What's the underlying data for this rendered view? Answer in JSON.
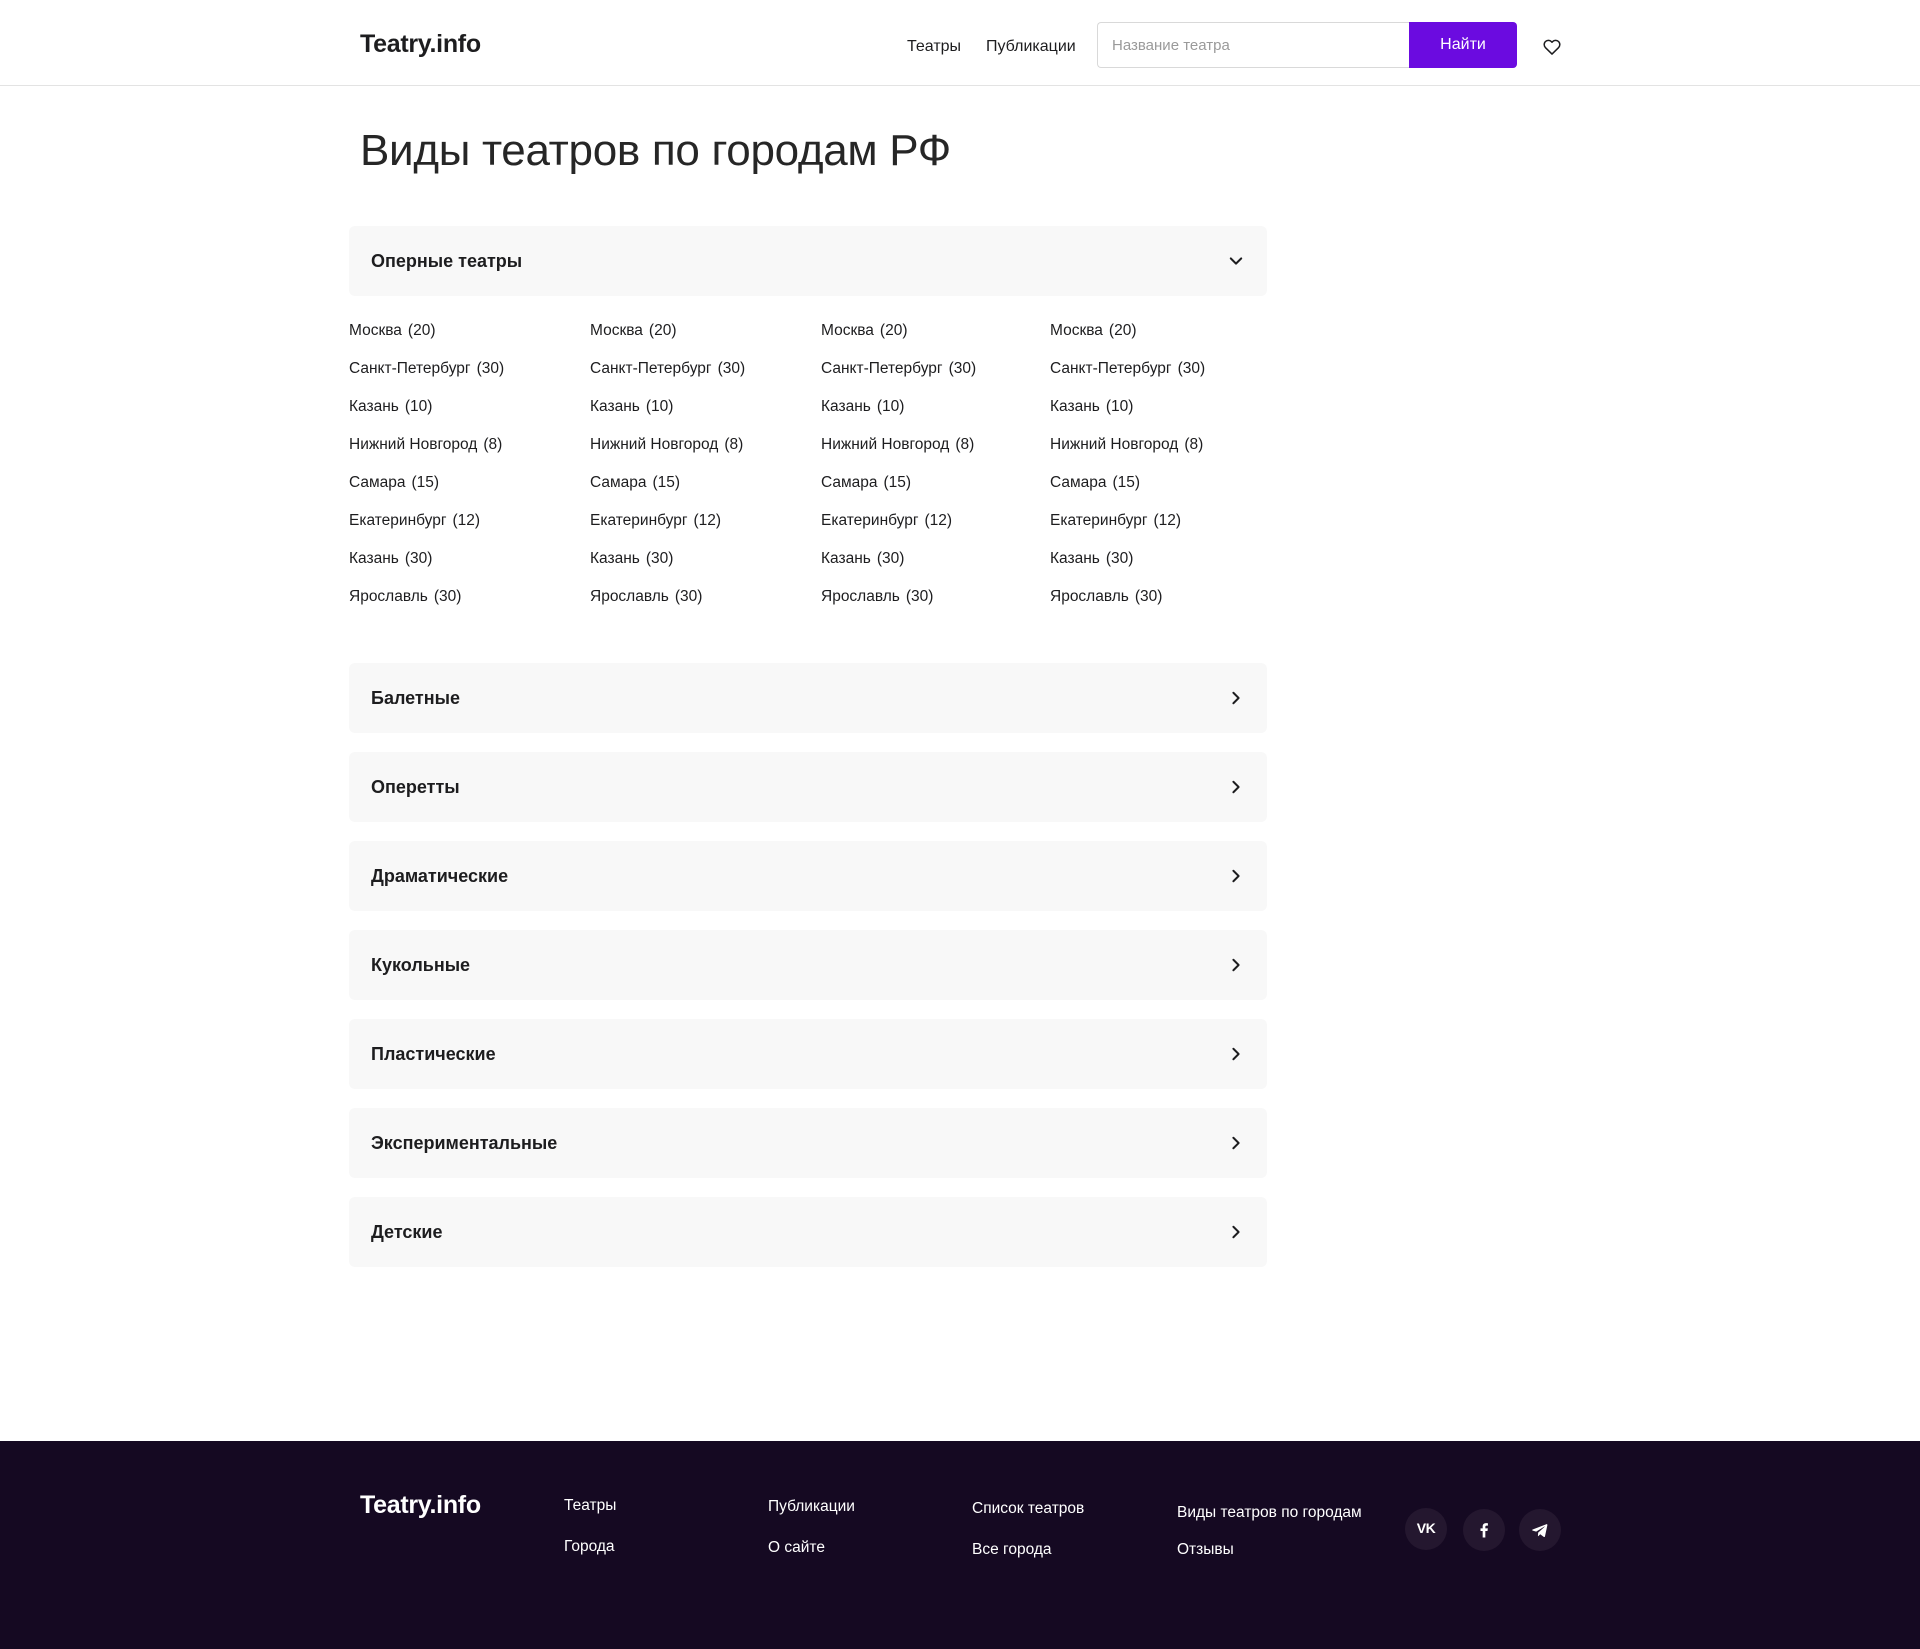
{
  "header": {
    "logo": "Teatry.info",
    "nav": [
      {
        "label": "Театры"
      },
      {
        "label": "Публикации"
      }
    ],
    "search": {
      "placeholder": "Название театра",
      "value": "",
      "button_label": "Найти"
    },
    "favorites_icon": "heart-icon"
  },
  "page": {
    "title": "Виды театров по городам РФ"
  },
  "accordion": {
    "open": {
      "label": "Оперные театры",
      "icon": "chevron-down-icon",
      "columns": [
        [
          {
            "city": "Москва",
            "count": "(20)"
          },
          {
            "city": "Санкт-Петербург",
            "count": "(30)"
          },
          {
            "city": "Казань",
            "count": "(10)"
          },
          {
            "city": "Нижний Новгород",
            "count": "(8)"
          },
          {
            "city": "Самара",
            "count": "(15)"
          },
          {
            "city": "Екатеринбург",
            "count": "(12)"
          },
          {
            "city": "Казань",
            "count": "(30)"
          },
          {
            "city": "Ярославль",
            "count": "(30)"
          }
        ],
        [
          {
            "city": "Москва",
            "count": "(20)"
          },
          {
            "city": "Санкт-Петербург",
            "count": "(30)"
          },
          {
            "city": "Казань",
            "count": "(10)"
          },
          {
            "city": "Нижний Новгород",
            "count": "(8)"
          },
          {
            "city": "Самара",
            "count": "(15)"
          },
          {
            "city": "Екатеринбург",
            "count": "(12)"
          },
          {
            "city": "Казань",
            "count": "(30)"
          },
          {
            "city": "Ярославль",
            "count": "(30)"
          }
        ],
        [
          {
            "city": "Москва",
            "count": "(20)"
          },
          {
            "city": "Санкт-Петербург",
            "count": "(30)"
          },
          {
            "city": "Казань",
            "count": "(10)"
          },
          {
            "city": "Нижний Новгород",
            "count": "(8)"
          },
          {
            "city": "Самара",
            "count": "(15)"
          },
          {
            "city": "Екатеринбург",
            "count": "(12)"
          },
          {
            "city": "Казань",
            "count": "(30)"
          },
          {
            "city": "Ярославль",
            "count": "(30)"
          }
        ],
        [
          {
            "city": "Москва",
            "count": "(20)"
          },
          {
            "city": "Санкт-Петербург",
            "count": "(30)"
          },
          {
            "city": "Казань",
            "count": "(10)"
          },
          {
            "city": "Нижний Новгород",
            "count": "(8)"
          },
          {
            "city": "Самара",
            "count": "(15)"
          },
          {
            "city": "Екатеринбург",
            "count": "(12)"
          },
          {
            "city": "Казань",
            "count": "(30)"
          },
          {
            "city": "Ярославль",
            "count": "(30)"
          }
        ]
      ]
    },
    "collapsed": [
      {
        "label": "Балетные",
        "icon": "chevron-right-icon"
      },
      {
        "label": "Оперетты",
        "icon": "chevron-right-icon"
      },
      {
        "label": "Драматические",
        "icon": "chevron-right-icon"
      },
      {
        "label": "Кукольные",
        "icon": "chevron-right-icon"
      },
      {
        "label": "Пластические",
        "icon": "chevron-right-icon"
      },
      {
        "label": "Экспериментальные",
        "icon": "chevron-right-icon"
      },
      {
        "label": "Детские",
        "icon": "chevron-right-icon"
      }
    ]
  },
  "footer": {
    "logo": "Teatry.info",
    "links": [
      {
        "label": "Театры"
      },
      {
        "label": "Города"
      },
      {
        "label": "Публикации"
      },
      {
        "label": "О сайте"
      },
      {
        "label": "Список театров"
      },
      {
        "label": "Все города"
      },
      {
        "label": "Виды театров по городам"
      },
      {
        "label": "Отзывы"
      }
    ],
    "social": [
      {
        "icon": "vk-icon",
        "text": "VK"
      },
      {
        "icon": "facebook-icon"
      },
      {
        "icon": "telegram-icon"
      }
    ],
    "colors": {
      "background": "#150922",
      "social_bg": "#24172f"
    }
  },
  "colors": {
    "accent": "#6b0be0",
    "panel": "#f8f8f8"
  }
}
